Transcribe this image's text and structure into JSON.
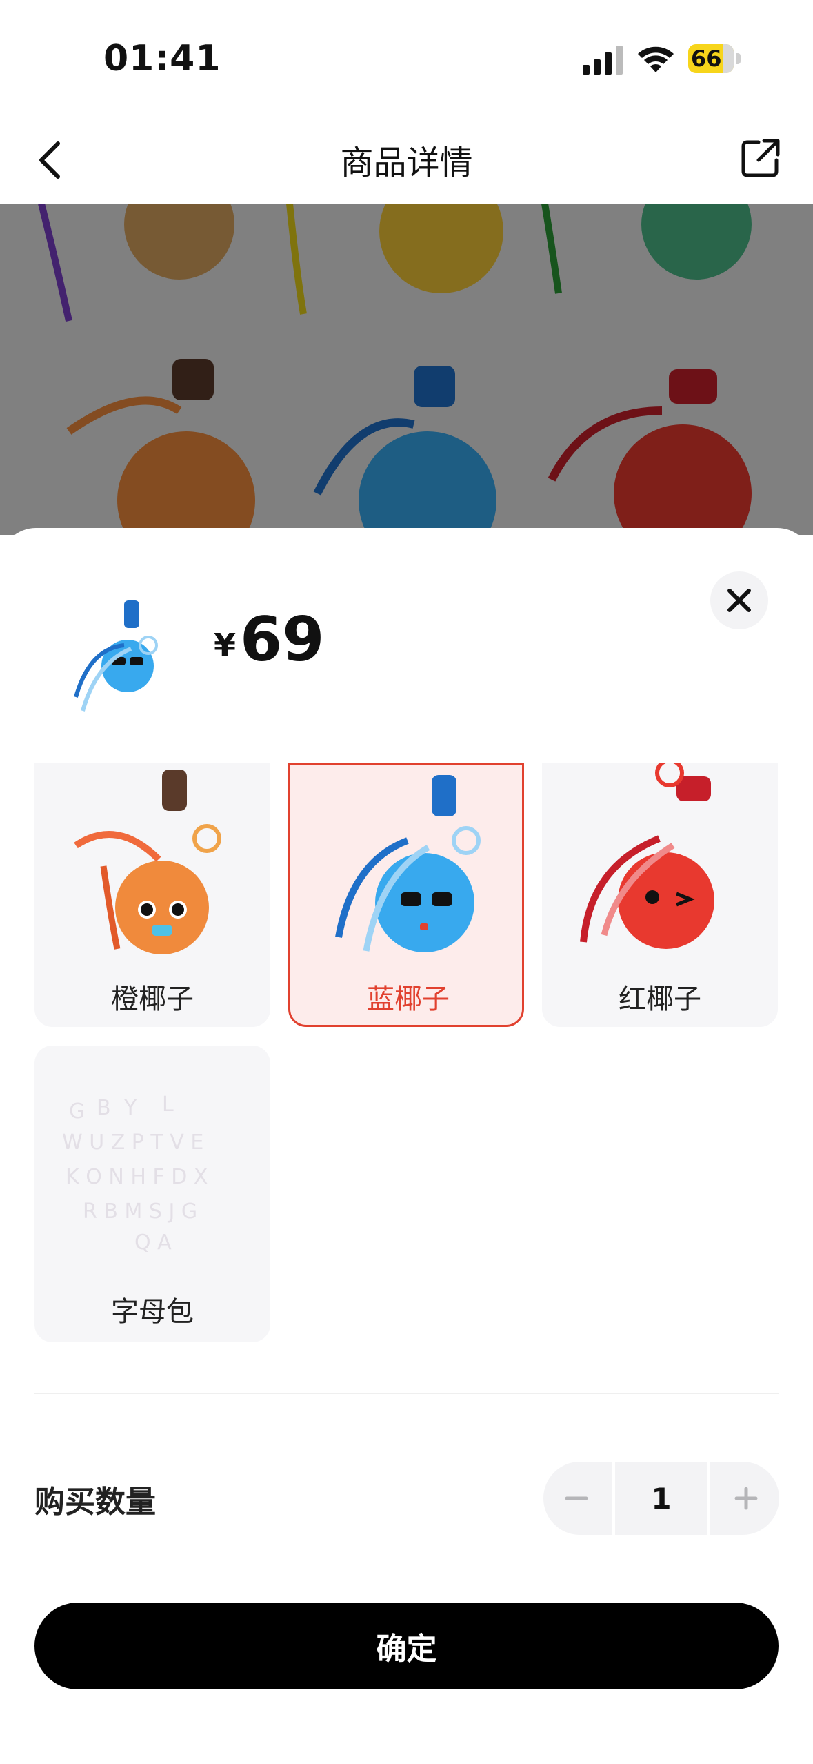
{
  "status_bar": {
    "time": "01:41",
    "battery": "66"
  },
  "nav": {
    "title": "商品详情"
  },
  "product": {
    "currency": "¥",
    "price": "69"
  },
  "options": [
    {
      "label": "橙椰子",
      "color": "#f08a3c"
    },
    {
      "label": "蓝椰子",
      "color": "#38a9ee",
      "selected": true
    },
    {
      "label": "红椰子",
      "color": "#e8392f"
    },
    {
      "label": "字母包",
      "color": "#e8e4ea"
    }
  ],
  "quantity": {
    "label": "购买数量",
    "value": "1",
    "minus": "−",
    "plus": "+"
  },
  "confirm": {
    "label": "确定"
  },
  "colors": {
    "accent": "#e1412f",
    "selected_bg": "#fdeceb",
    "option_bg": "#f6f6f8",
    "button_bg": "#000000"
  }
}
